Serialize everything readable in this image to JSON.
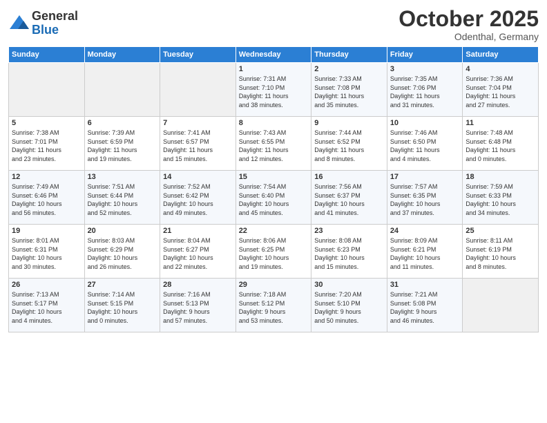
{
  "logo": {
    "general": "General",
    "blue": "Blue"
  },
  "title": {
    "month": "October 2025",
    "location": "Odenthal, Germany"
  },
  "headers": [
    "Sunday",
    "Monday",
    "Tuesday",
    "Wednesday",
    "Thursday",
    "Friday",
    "Saturday"
  ],
  "weeks": [
    [
      {
        "day": "",
        "info": ""
      },
      {
        "day": "",
        "info": ""
      },
      {
        "day": "",
        "info": ""
      },
      {
        "day": "1",
        "info": "Sunrise: 7:31 AM\nSunset: 7:10 PM\nDaylight: 11 hours\nand 38 minutes."
      },
      {
        "day": "2",
        "info": "Sunrise: 7:33 AM\nSunset: 7:08 PM\nDaylight: 11 hours\nand 35 minutes."
      },
      {
        "day": "3",
        "info": "Sunrise: 7:35 AM\nSunset: 7:06 PM\nDaylight: 11 hours\nand 31 minutes."
      },
      {
        "day": "4",
        "info": "Sunrise: 7:36 AM\nSunset: 7:04 PM\nDaylight: 11 hours\nand 27 minutes."
      }
    ],
    [
      {
        "day": "5",
        "info": "Sunrise: 7:38 AM\nSunset: 7:01 PM\nDaylight: 11 hours\nand 23 minutes."
      },
      {
        "day": "6",
        "info": "Sunrise: 7:39 AM\nSunset: 6:59 PM\nDaylight: 11 hours\nand 19 minutes."
      },
      {
        "day": "7",
        "info": "Sunrise: 7:41 AM\nSunset: 6:57 PM\nDaylight: 11 hours\nand 15 minutes."
      },
      {
        "day": "8",
        "info": "Sunrise: 7:43 AM\nSunset: 6:55 PM\nDaylight: 11 hours\nand 12 minutes."
      },
      {
        "day": "9",
        "info": "Sunrise: 7:44 AM\nSunset: 6:52 PM\nDaylight: 11 hours\nand 8 minutes."
      },
      {
        "day": "10",
        "info": "Sunrise: 7:46 AM\nSunset: 6:50 PM\nDaylight: 11 hours\nand 4 minutes."
      },
      {
        "day": "11",
        "info": "Sunrise: 7:48 AM\nSunset: 6:48 PM\nDaylight: 11 hours\nand 0 minutes."
      }
    ],
    [
      {
        "day": "12",
        "info": "Sunrise: 7:49 AM\nSunset: 6:46 PM\nDaylight: 10 hours\nand 56 minutes."
      },
      {
        "day": "13",
        "info": "Sunrise: 7:51 AM\nSunset: 6:44 PM\nDaylight: 10 hours\nand 52 minutes."
      },
      {
        "day": "14",
        "info": "Sunrise: 7:52 AM\nSunset: 6:42 PM\nDaylight: 10 hours\nand 49 minutes."
      },
      {
        "day": "15",
        "info": "Sunrise: 7:54 AM\nSunset: 6:40 PM\nDaylight: 10 hours\nand 45 minutes."
      },
      {
        "day": "16",
        "info": "Sunrise: 7:56 AM\nSunset: 6:37 PM\nDaylight: 10 hours\nand 41 minutes."
      },
      {
        "day": "17",
        "info": "Sunrise: 7:57 AM\nSunset: 6:35 PM\nDaylight: 10 hours\nand 37 minutes."
      },
      {
        "day": "18",
        "info": "Sunrise: 7:59 AM\nSunset: 6:33 PM\nDaylight: 10 hours\nand 34 minutes."
      }
    ],
    [
      {
        "day": "19",
        "info": "Sunrise: 8:01 AM\nSunset: 6:31 PM\nDaylight: 10 hours\nand 30 minutes."
      },
      {
        "day": "20",
        "info": "Sunrise: 8:03 AM\nSunset: 6:29 PM\nDaylight: 10 hours\nand 26 minutes."
      },
      {
        "day": "21",
        "info": "Sunrise: 8:04 AM\nSunset: 6:27 PM\nDaylight: 10 hours\nand 22 minutes."
      },
      {
        "day": "22",
        "info": "Sunrise: 8:06 AM\nSunset: 6:25 PM\nDaylight: 10 hours\nand 19 minutes."
      },
      {
        "day": "23",
        "info": "Sunrise: 8:08 AM\nSunset: 6:23 PM\nDaylight: 10 hours\nand 15 minutes."
      },
      {
        "day": "24",
        "info": "Sunrise: 8:09 AM\nSunset: 6:21 PM\nDaylight: 10 hours\nand 11 minutes."
      },
      {
        "day": "25",
        "info": "Sunrise: 8:11 AM\nSunset: 6:19 PM\nDaylight: 10 hours\nand 8 minutes."
      }
    ],
    [
      {
        "day": "26",
        "info": "Sunrise: 7:13 AM\nSunset: 5:17 PM\nDaylight: 10 hours\nand 4 minutes."
      },
      {
        "day": "27",
        "info": "Sunrise: 7:14 AM\nSunset: 5:15 PM\nDaylight: 10 hours\nand 0 minutes."
      },
      {
        "day": "28",
        "info": "Sunrise: 7:16 AM\nSunset: 5:13 PM\nDaylight: 9 hours\nand 57 minutes."
      },
      {
        "day": "29",
        "info": "Sunrise: 7:18 AM\nSunset: 5:12 PM\nDaylight: 9 hours\nand 53 minutes."
      },
      {
        "day": "30",
        "info": "Sunrise: 7:20 AM\nSunset: 5:10 PM\nDaylight: 9 hours\nand 50 minutes."
      },
      {
        "day": "31",
        "info": "Sunrise: 7:21 AM\nSunset: 5:08 PM\nDaylight: 9 hours\nand 46 minutes."
      },
      {
        "day": "",
        "info": ""
      }
    ]
  ]
}
